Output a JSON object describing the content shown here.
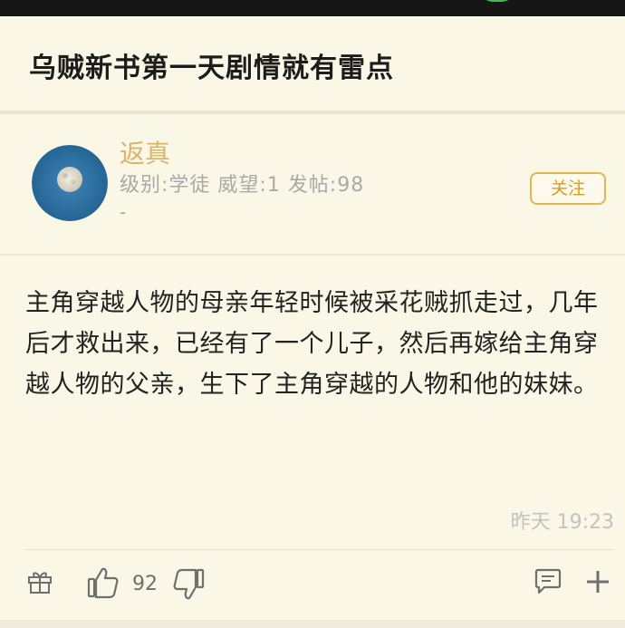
{
  "header": {
    "title": "乌贼新书第一天剧情就有雷点"
  },
  "author": {
    "name": "返真",
    "meta": "级别:学徒 威望:1 发帖:98",
    "meta_extra": "-",
    "follow_label": "关注"
  },
  "post": {
    "body": "主角穿越人物的母亲年轻时候被采花贼抓走过，几年后才救出来，已经有了一个儿子，然后再嫁给主角穿越人物的父亲，生下了主角穿越的人物和他的妹妹。",
    "time": "昨天 19:23"
  },
  "actions": {
    "like_count": "92",
    "icons": [
      "gift-icon",
      "thumbs-up-icon",
      "thumbs-down-icon",
      "comment-icon",
      "plus-icon"
    ]
  },
  "colors": {
    "background": "#fbf7e6",
    "accent": "#d9b46a",
    "follow_border": "#e0b64e"
  }
}
